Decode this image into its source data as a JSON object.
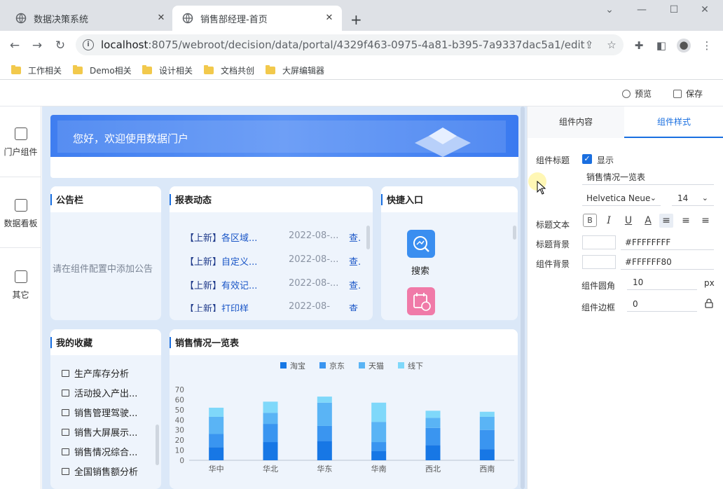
{
  "browser": {
    "tabs": [
      {
        "title": "数据决策系统",
        "active": false
      },
      {
        "title": "销售部经理-首页",
        "active": true
      }
    ],
    "url_host": "localhost",
    "url_rest": ":8075/webroot/decision/data/portal/4329f463-0975-4a81-b395-7a9337dac5a1/edit",
    "bookmarks": [
      "工作相关",
      "Demo相关",
      "设计相关",
      "文档共创",
      "大屏编辑器"
    ]
  },
  "app_header": {
    "preview": "预览",
    "save": "保存"
  },
  "left_nav": {
    "items": [
      "门户组件",
      "数据看板",
      "其它"
    ]
  },
  "banner": {
    "welcome": "您好，欢迎使用数据门户"
  },
  "notice_card": {
    "title": "公告栏",
    "empty": "请在组件配置中添加公告"
  },
  "report_card": {
    "title": "报表动态",
    "rows": [
      {
        "tag": "【上新】",
        "name": "各区域...",
        "date": "2022-08-...",
        "action": "查."
      },
      {
        "tag": "【上新】",
        "name": "自定义...",
        "date": "2022-08-...",
        "action": "查."
      },
      {
        "tag": "【上新】",
        "name": "有效记...",
        "date": "2022-08-...",
        "action": "查."
      },
      {
        "tag": "【上新】",
        "name": "打印样",
        "date": "2022-08-",
        "action": "查"
      }
    ]
  },
  "quick_card": {
    "title": "快捷入口",
    "search": "搜索"
  },
  "fav_card": {
    "title": "我的收藏",
    "items": [
      "生产库存分析",
      "活动投入产出...",
      "销售管理驾驶...",
      "销售大屏展示...",
      "销售情况综合...",
      "全国销售额分析"
    ]
  },
  "sales_card": {
    "title": "销售情况一览表"
  },
  "chart_data": {
    "type": "bar",
    "stacked": true,
    "title": "销售情况一览表",
    "categories": [
      "华中",
      "华北",
      "华东",
      "华南",
      "西北",
      "西南"
    ],
    "series": [
      {
        "name": "淘宝",
        "color": "#1777e5",
        "values": [
          13,
          18,
          19,
          9,
          15,
          11
        ]
      },
      {
        "name": "京东",
        "color": "#3a95f0",
        "values": [
          13,
          18,
          15,
          9,
          17,
          19
        ]
      },
      {
        "name": "天猫",
        "color": "#5ab4f5",
        "values": [
          17,
          11,
          23,
          20,
          10,
          13
        ]
      },
      {
        "name": "线下",
        "color": "#7fd8fa",
        "values": [
          9,
          11,
          6,
          19,
          7,
          5
        ]
      }
    ],
    "yticks": [
      0,
      10,
      20,
      30,
      40,
      50,
      60,
      70
    ],
    "ylim": [
      0,
      70
    ],
    "legend": "top"
  },
  "right_panel": {
    "tabs": [
      "组件内容",
      "组件样式"
    ],
    "title_label": "组件标题",
    "show_label": "显示",
    "title_value": "销售情况一览表",
    "font": "Helvetica Neue",
    "font_size": "14",
    "title_text_label": "标题文本",
    "title_bg_label": "标题背景",
    "title_bg_value": "#FFFFFFFF",
    "comp_bg_label": "组件背景",
    "comp_bg_value": "#FFFFFF80",
    "radius_label": "组件圆角",
    "radius_value": "10",
    "radius_unit": "px",
    "border_label": "组件边框",
    "border_value": "0"
  }
}
